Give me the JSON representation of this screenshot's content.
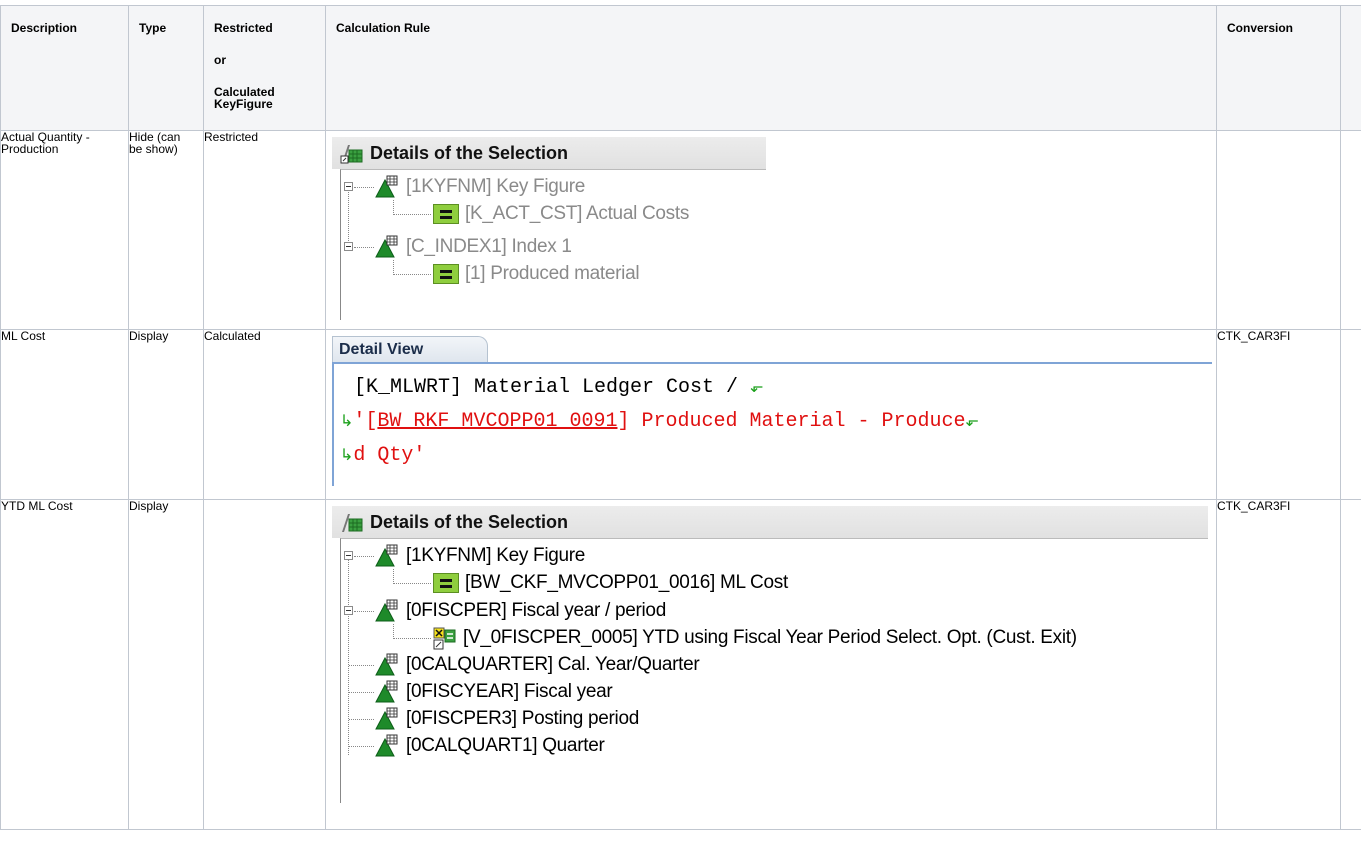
{
  "columns": {
    "description": "Description",
    "type": "Type",
    "rc_line1": "Restricted",
    "rc_line2": "or",
    "rc_line3": "Calculated",
    "rc_line4": "KeyFigure",
    "rule": "Calculation Rule",
    "conversion": "Conversion"
  },
  "rows": [
    {
      "desc_line1": "Actual Quantity -",
      "desc_line2": "Production",
      "type_line1": "Hide (can",
      "type_line2": "be show)",
      "rc": "Restricted",
      "conversion": "",
      "panel": {
        "title": "Details of the Selection",
        "nodes": [
          "[1KYFNM] Key Figure",
          "[K_ACT_CST] Actual Costs",
          "[C_INDEX1] Index 1",
          "[1] Produced material"
        ]
      }
    },
    {
      "desc": "ML Cost",
      "type": "Display",
      "rc": "Calculated",
      "conversion": "CTK_CAR3FI",
      "detail_view": {
        "tab": "Detail View",
        "line1": "[K_MLWRT] Material Ledger Cost /",
        "line2_a": "'[",
        "line2_b": "BW_RKF_MVCOPP01_0091",
        "line2_c": "] Produced Material - Produce",
        "line3": "d Qty'"
      }
    },
    {
      "desc": "YTD ML Cost",
      "type": "Display",
      "rc": "",
      "conversion": "CTK_CAR3FI",
      "panel": {
        "title": "Details of the Selection",
        "nodes": [
          "[1KYFNM] Key Figure",
          "[BW_CKF_MVCOPP01_0016] ML Cost",
          "[0FISCPER] Fiscal year / period",
          "[V_0FISCPER_0005] YTD using Fiscal Year Period Select. Opt. (Cust. Exit)",
          "[0CALQUARTER] Cal. Year/Quarter",
          "[0FISCYEAR] Fiscal year",
          "[0FISCPER3] Posting period",
          "[0CALQUART1] Quarter"
        ]
      }
    }
  ]
}
